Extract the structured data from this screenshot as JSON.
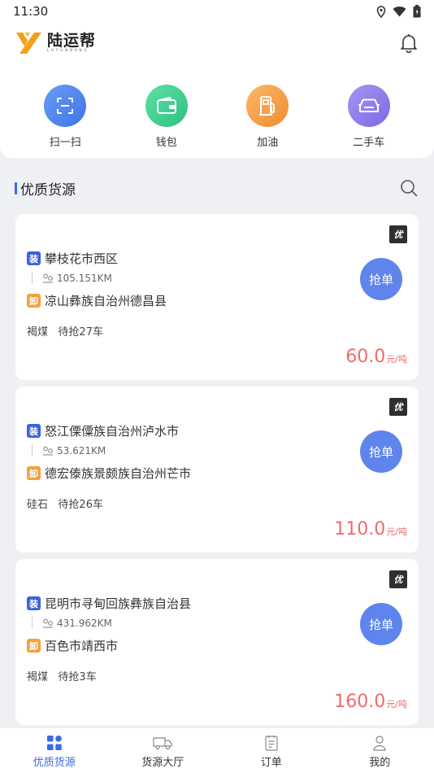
{
  "status": {
    "time": "11:30"
  },
  "header": {
    "logo_text": "陆运帮",
    "logo_sub": "LUYUNBANG"
  },
  "quick_actions": [
    {
      "label": "扫一扫",
      "icon": "scan-icon",
      "color": "#4f86ee"
    },
    {
      "label": "钱包",
      "icon": "wallet-icon",
      "color": "#3fcf93"
    },
    {
      "label": "加油",
      "icon": "fuel-icon",
      "color": "#f7a04a"
    },
    {
      "label": "二手车",
      "icon": "used-car-icon",
      "color": "#8a78ea"
    }
  ],
  "section": {
    "title": "优质货源"
  },
  "cards": [
    {
      "badge": "优",
      "load": "装",
      "origin": "攀枝花市西区",
      "distance": "105.151KM",
      "unload": "卸",
      "destination": "凉山彝族自治州德昌县",
      "goods": "褐煤",
      "remaining": "待抢27车",
      "button": "抢单",
      "price": "60.0",
      "unit": "元/吨"
    },
    {
      "badge": "优",
      "load": "装",
      "origin": "怒江傈僳族自治州泸水市",
      "distance": "53.621KM",
      "unload": "卸",
      "destination": "德宏傣族景颇族自治州芒市",
      "goods": "硅石",
      "remaining": "待抢26车",
      "button": "抢单",
      "price": "110.0",
      "unit": "元/吨"
    },
    {
      "badge": "优",
      "load": "装",
      "origin": "昆明市寻甸回族彝族自治县",
      "distance": "431.962KM",
      "unload": "卸",
      "destination": "百色市靖西市",
      "goods": "褐煤",
      "remaining": "待抢3车",
      "button": "抢单",
      "price": "160.0",
      "unit": "元/吨"
    }
  ],
  "tabs": [
    {
      "label": "优质货源",
      "icon": "grid-icon",
      "active": true
    },
    {
      "label": "货源大厅",
      "icon": "truck-icon",
      "active": false
    },
    {
      "label": "订单",
      "icon": "order-icon",
      "active": false
    },
    {
      "label": "我的",
      "icon": "user-icon",
      "active": false
    }
  ],
  "colors": {
    "accent": "#3a6ae6",
    "price": "#ef6b6b",
    "load_tag": "#3a63e0",
    "unload_tag": "#f3a23c",
    "grab_button": "#5f85ec"
  }
}
